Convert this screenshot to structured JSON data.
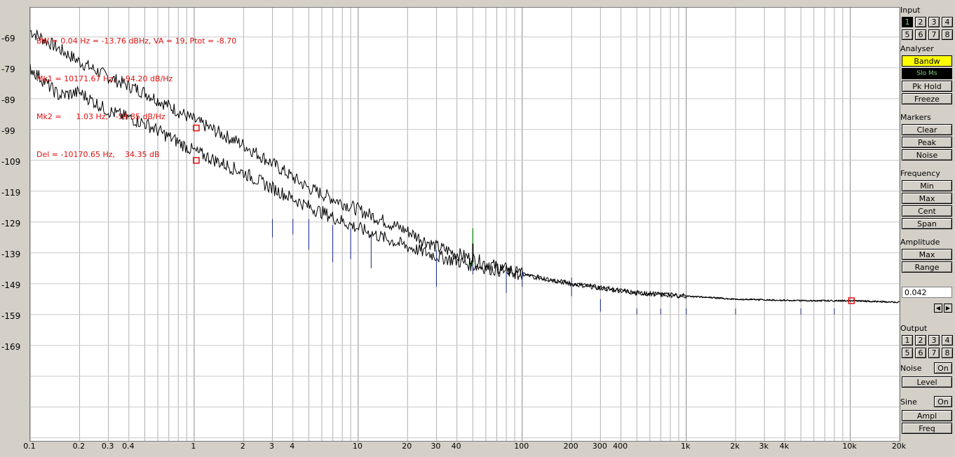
{
  "readout": {
    "line1": "BW = 0.04 Hz = -13.76 dBHz, VA = 19, Ptot = -8.70",
    "line2": "Mk1 = 10171.67 Hz,   -94.20 dB/Hz",
    "line3": "Mk2 =      1.03 Hz,   -59.85 dB/Hz",
    "line4": "Del = -10170.65 Hz,    34.35 dB"
  },
  "y_axis": {
    "labels": [
      "-69",
      "-79",
      "-89",
      "-99",
      "-109",
      "-119",
      "-129",
      "-139",
      "-149",
      "-159",
      "-169"
    ],
    "label_y": [
      55,
      99,
      143,
      187,
      231,
      275,
      319,
      363,
      407,
      451,
      495
    ]
  },
  "x_axis": {
    "labels": [
      "0.1",
      "0.2",
      "0.3",
      "0.4",
      "1",
      "2",
      "3",
      "4",
      "10",
      "20",
      "30",
      "40",
      "100",
      "200",
      "300",
      "400",
      "1k",
      "2k",
      "3k",
      "4k",
      "10k",
      "20k"
    ],
    "values": [
      0.1,
      0.2,
      0.3,
      0.4,
      1,
      2,
      3,
      4,
      10,
      20,
      30,
      40,
      100,
      200,
      300,
      400,
      1000,
      2000,
      3000,
      4000,
      10000,
      20000
    ],
    "min": 0.1,
    "max": 20000
  },
  "chart_data": {
    "type": "line",
    "xscale": "log",
    "xlim": [
      0.1,
      20000
    ],
    "series": [
      {
        "x": [
          0.1,
          0.2,
          0.3,
          0.5,
          1,
          2,
          3,
          5,
          10,
          20,
          30,
          50,
          100,
          200,
          500,
          1000,
          2000,
          5000,
          10000,
          20000
        ],
        "y": [
          -67,
          -77,
          -82,
          -87,
          -96,
          -104,
          -110,
          -118,
          -125,
          -132,
          -137,
          -141,
          -146,
          -149,
          -152,
          -153,
          -154,
          -154.5,
          -154.5,
          -155
        ]
      },
      {
        "x": [
          0.1,
          0.15,
          0.2,
          0.3,
          0.5,
          1,
          2,
          3,
          5,
          10,
          20,
          30,
          50,
          100,
          200,
          500,
          1000,
          2000,
          5000,
          10000,
          20000
        ],
        "y": [
          -79,
          -88,
          -87,
          -93,
          -97,
          -106,
          -113,
          -118,
          -124,
          -131,
          -137,
          -140,
          -143,
          -146,
          -149,
          -152,
          -153,
          -154,
          -154.5,
          -154.5,
          -155
        ]
      }
    ],
    "markers": [
      {
        "x": 1.03,
        "y": -98.5
      },
      {
        "x": 1.03,
        "y": -109
      },
      {
        "x": 10171.67,
        "y": -154.5
      }
    ]
  },
  "panel": {
    "input_label": "Input",
    "inputs": [
      "1",
      "2",
      "3",
      "4",
      "5",
      "6",
      "7",
      "8"
    ],
    "analyser_label": "Analyser",
    "bandw": "Bandw",
    "display": "Slo Ms",
    "pkhold": "Pk Hold",
    "freeze": "Freeze",
    "markers_label": "Markers",
    "clear": "Clear",
    "peak": "Peak",
    "noise": "Noise",
    "frequency_label": "Frequency",
    "min": "Min",
    "max": "Max",
    "cent": "Cent",
    "span": "Span",
    "amplitude_label": "Amplitude",
    "amax": "Max",
    "range": "Range",
    "value": "0.042",
    "output_label": "Output",
    "outputs": [
      "1",
      "2",
      "3",
      "4",
      "5",
      "6",
      "7",
      "8"
    ],
    "noise_label": "Noise",
    "noise_on": "On",
    "level": "Level",
    "sine_label": "Sine",
    "sine_on": "On",
    "ampl": "Ampl",
    "freq": "Freq"
  },
  "colors": {
    "trace": "#000000",
    "marker": "#e01010",
    "spikes": "#1a2a8a",
    "grid": "#a0a0a0"
  }
}
